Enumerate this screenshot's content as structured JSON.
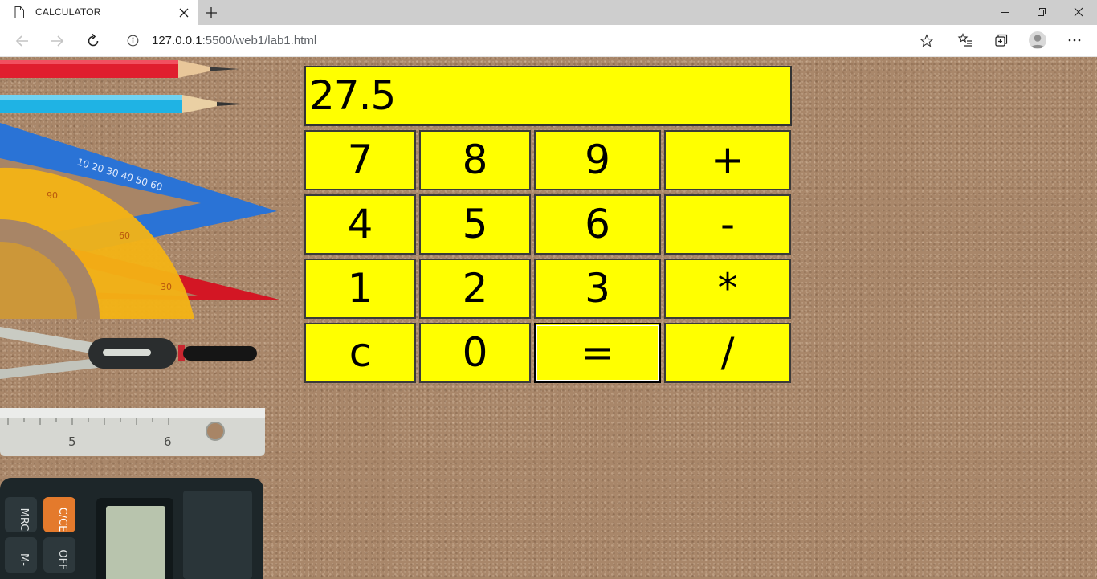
{
  "browser": {
    "tab_title": "CALCULATOR",
    "url_host": "127.0.0.1",
    "url_rest": ":5500/web1/lab1.html"
  },
  "calculator": {
    "display": "27.5",
    "keys": {
      "k7": "7",
      "k8": "8",
      "k9": "9",
      "plus": "+",
      "k4": "4",
      "k5": "5",
      "k6": "6",
      "minus": "-",
      "k1": "1",
      "k2": "2",
      "k3": "3",
      "multiply": "*",
      "clear": "c",
      "k0": "0",
      "equals": "=",
      "divide": "/"
    },
    "colors": {
      "key_background": "#ffff00",
      "key_border": "#333333"
    }
  },
  "background_calculator": {
    "labels": [
      "MRC",
      "C/CE",
      "M-",
      "OFF"
    ]
  },
  "ruler": {
    "numbers": [
      "5",
      "6"
    ]
  }
}
